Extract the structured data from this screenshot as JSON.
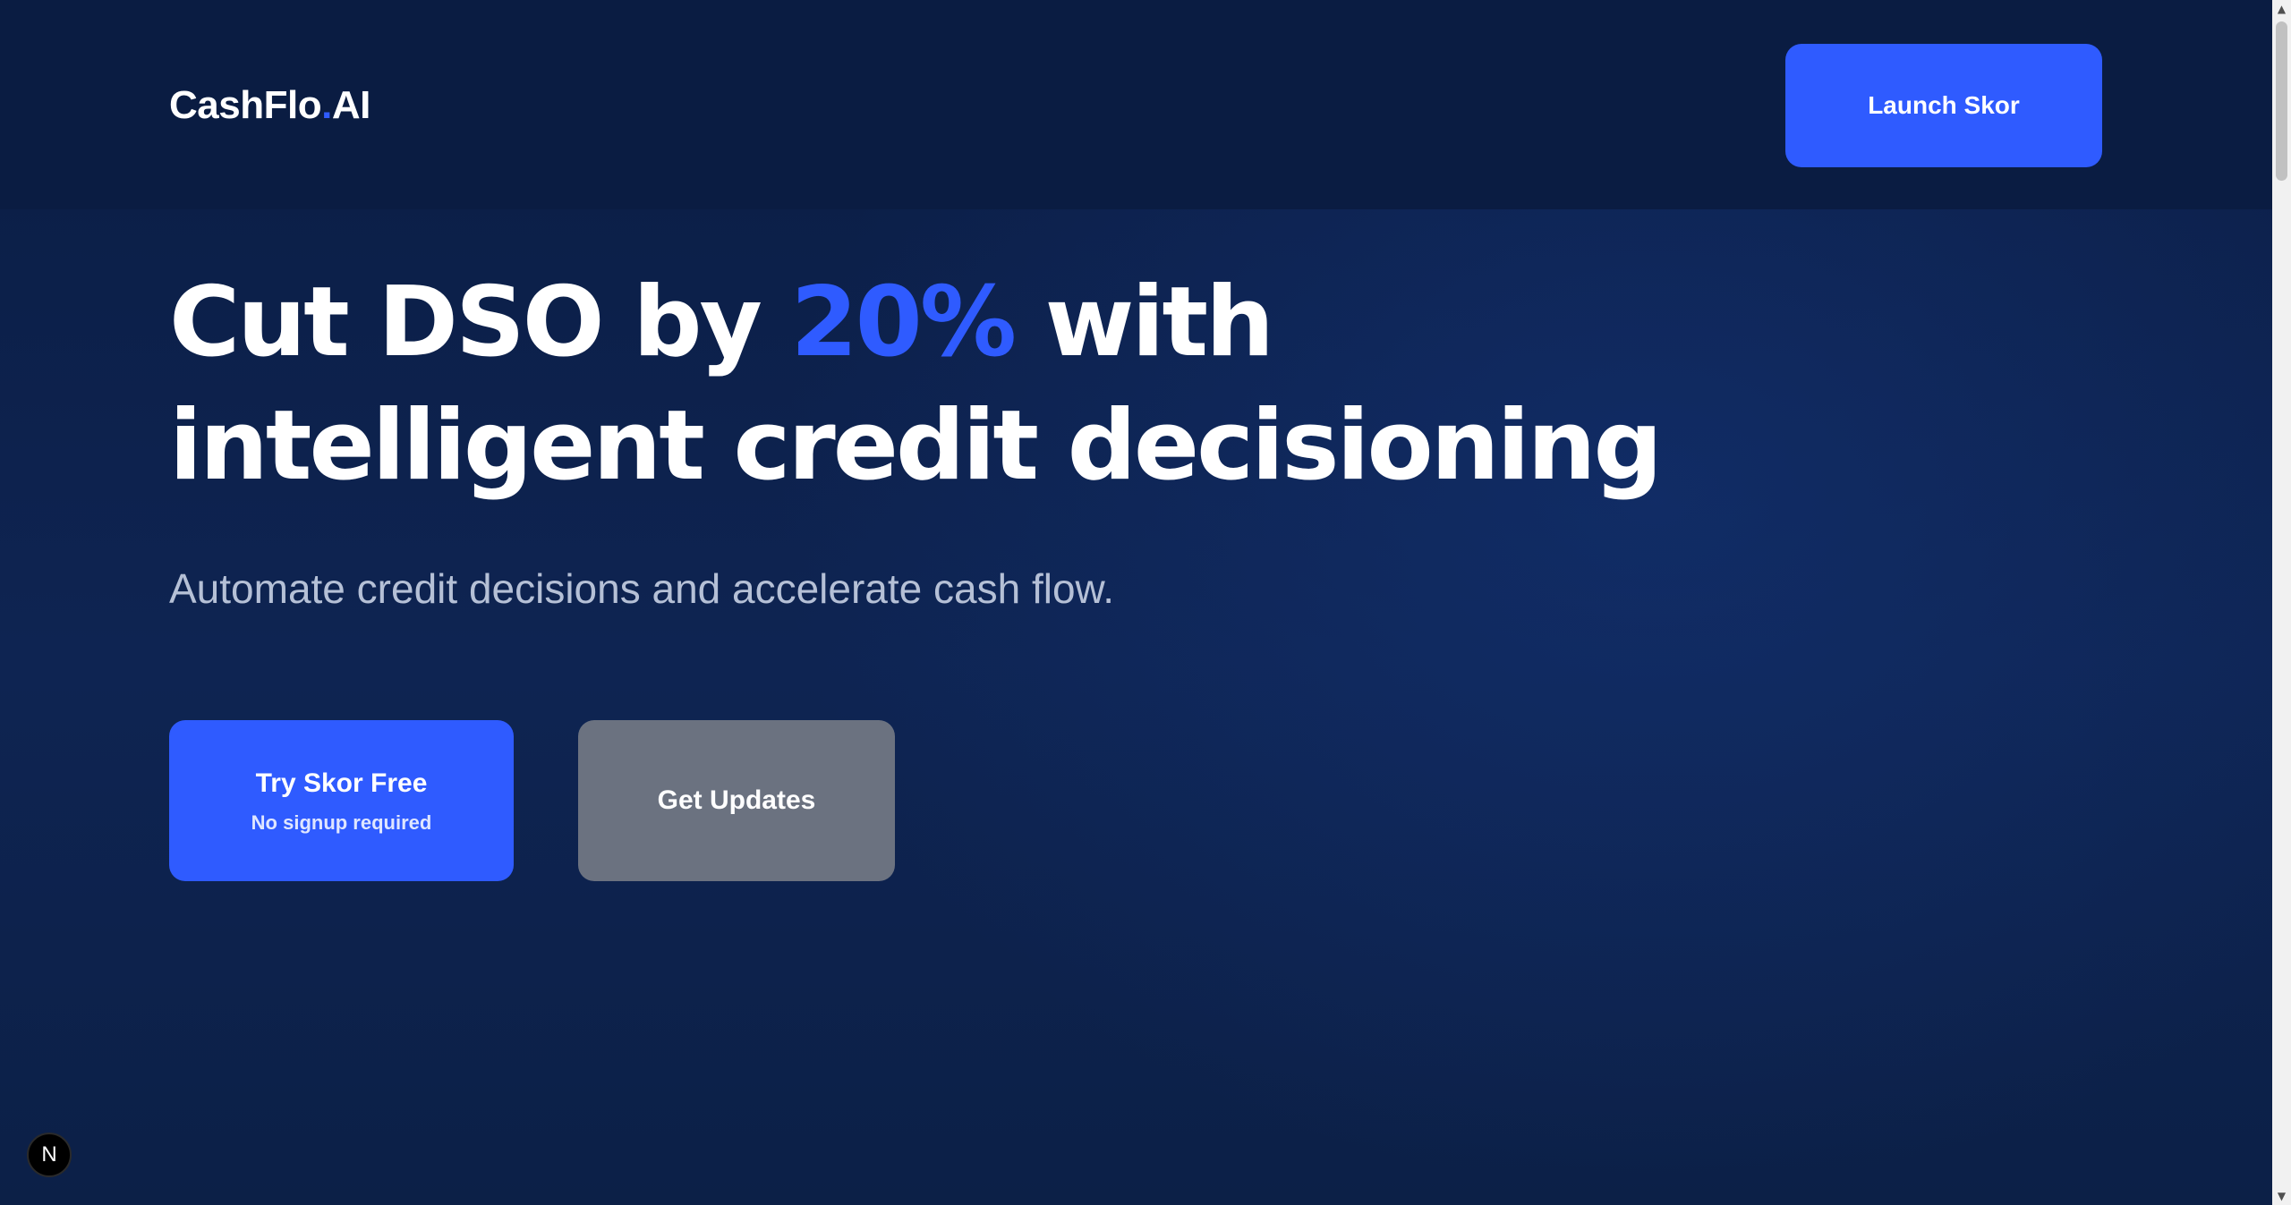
{
  "header": {
    "logo_main": "CashFlo",
    "logo_dot": ".",
    "logo_suffix": "AI",
    "launch_label": "Launch Skor"
  },
  "hero": {
    "headline_part1": "Cut DSO by ",
    "headline_accent": "20%",
    "headline_part2": " with intelligent credit decisioning",
    "subheadline": "Automate credit decisions and accelerate cash flow.",
    "primary_cta_label": "Try Skor Free",
    "primary_cta_sublabel": "No signup required",
    "secondary_cta_label": "Get Updates"
  },
  "dev_badge": {
    "letter": "N"
  },
  "scrollbar": {
    "up_icon": "▲",
    "down_icon": "▼"
  },
  "colors": {
    "background": "#0b1d44",
    "accent": "#2f5bff",
    "secondary_button": "#6b7280",
    "subtext": "#b5c0d6"
  }
}
